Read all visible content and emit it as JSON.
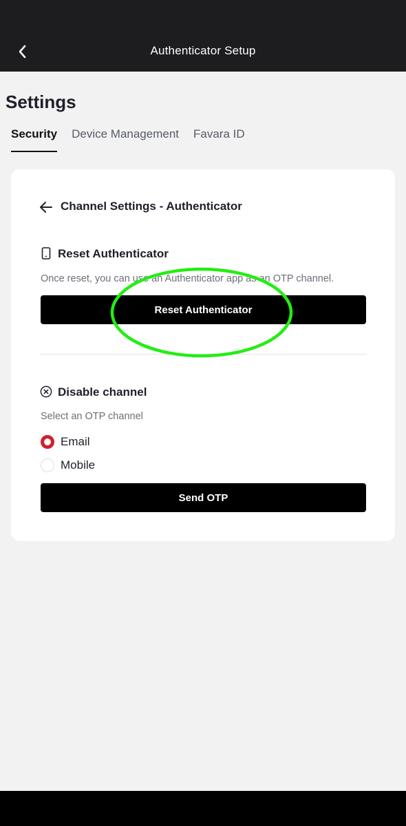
{
  "header": {
    "title": "Authenticator Setup",
    "back_icon": "chevron-left-icon"
  },
  "page": {
    "title": "Settings"
  },
  "tabs": [
    {
      "label": "Security",
      "active": true
    },
    {
      "label": "Device Management",
      "active": false
    },
    {
      "label": "Favara ID",
      "active": false
    }
  ],
  "card": {
    "title": "Channel Settings - Authenticator",
    "back_icon": "arrow-left-icon",
    "reset": {
      "icon": "phone-icon",
      "title": "Reset Authenticator",
      "description": "Once reset, you can use an Authenticator app as an OTP channel.",
      "button_label": "Reset Authenticator"
    },
    "disable": {
      "icon": "circle-x-icon",
      "title": "Disable channel",
      "helper": "Select an OTP channel",
      "options": [
        {
          "label": "Email",
          "selected": true
        },
        {
          "label": "Mobile",
          "selected": false
        }
      ],
      "button_label": "Send OTP"
    }
  },
  "colors": {
    "topbar": "#1d1d1f",
    "radio_selected": "#d0202e",
    "annotation_ring": "#22ee11"
  }
}
